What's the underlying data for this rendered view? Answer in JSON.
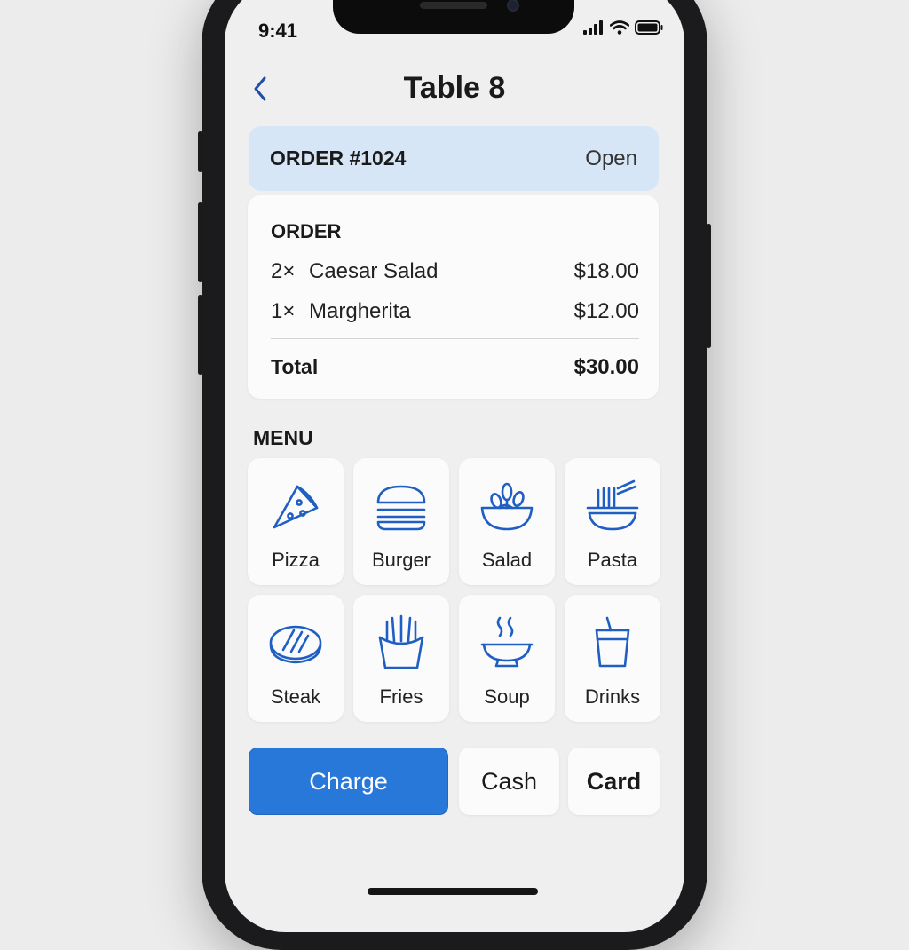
{
  "status_bar": {
    "time": "9:41"
  },
  "header": {
    "title": "Table 8"
  },
  "order": {
    "number": "ORDER #1024",
    "status": "Open",
    "section_title": "ORDER",
    "items": [
      {
        "qty": "2×",
        "name": "Caesar Salad",
        "price": "$18.00"
      },
      {
        "qty": "1×",
        "name": "Margherita",
        "price": "$12.00"
      }
    ],
    "total_label": "Total",
    "total_value": "$30.00"
  },
  "menu": {
    "title": "MENU",
    "items": [
      {
        "label": "Pizza",
        "icon": "pizza-icon"
      },
      {
        "label": "Burger",
        "icon": "burger-icon"
      },
      {
        "label": "Salad",
        "icon": "salad-icon"
      },
      {
        "label": "Pasta",
        "icon": "pasta-icon"
      },
      {
        "label": "Steak",
        "icon": "steak-icon"
      },
      {
        "label": "Fries",
        "icon": "fries-icon"
      },
      {
        "label": "Soup",
        "icon": "soup-icon"
      },
      {
        "label": "Drinks",
        "icon": "drinks-icon"
      }
    ]
  },
  "actions": {
    "charge": "Charge",
    "cash": "Cash",
    "card": "Card"
  },
  "colors": {
    "accent": "#2878da",
    "icon_blue": "#1f5fc4",
    "order_header_bg": "#d7e6f7"
  }
}
